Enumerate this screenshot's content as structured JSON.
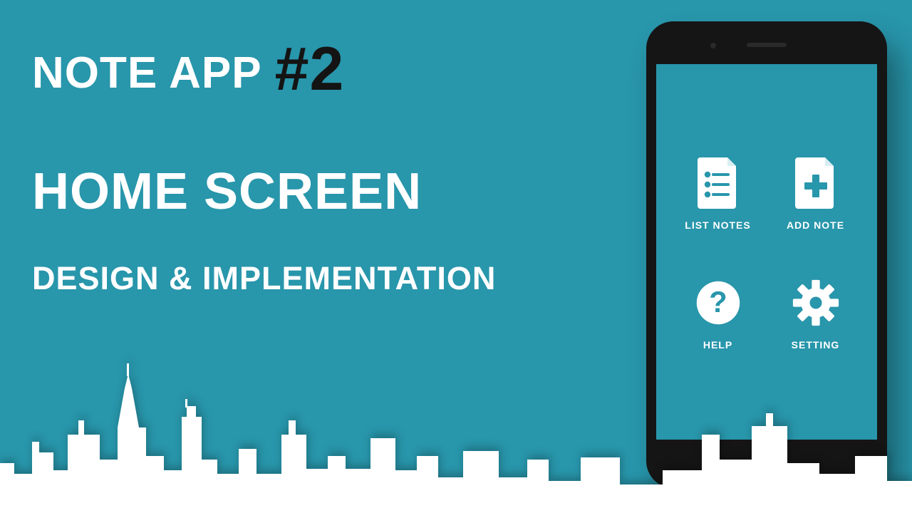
{
  "heading": {
    "prefix": "NOTE APP",
    "number": "#2",
    "line2": "HOME SCREEN",
    "line3": "DESIGN & IMPLEMENTATION"
  },
  "menu": {
    "list_notes": "LIST NOTES",
    "add_note": "ADD NOTE",
    "help": "HELP",
    "setting": "SETTING"
  },
  "colors": {
    "background": "#2896ab",
    "accent_dark": "#141414",
    "white": "#ffffff"
  }
}
